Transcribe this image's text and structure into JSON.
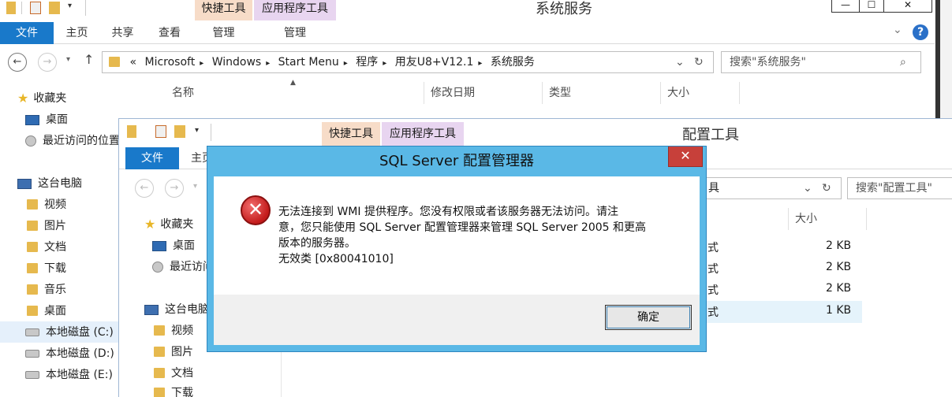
{
  "back_window": {
    "title": "系统服务",
    "ctx_tabs": [
      "快捷工具",
      "应用程序工具"
    ],
    "ribbon_tabs": [
      "文件",
      "主页",
      "共享",
      "查看",
      "管理",
      "管理"
    ],
    "win_buttons": [
      "—",
      "☐",
      "✕"
    ],
    "address": {
      "prefix": "«",
      "parts": [
        "Microsoft",
        "Windows",
        "Start Menu",
        "程序",
        "用友U8+V12.1",
        "系统服务"
      ]
    },
    "search_placeholder": "搜索\"系统服务\"",
    "nav": {
      "favorites": "收藏夹",
      "desktop": "桌面",
      "recent": "最近访问的位置",
      "this_pc": "这台电脑",
      "videos": "视频",
      "pictures": "图片",
      "documents": "文档",
      "downloads": "下载",
      "music": "音乐",
      "desktop2": "桌面",
      "drive_c": "本地磁盘 (C:)",
      "drive_d": "本地磁盘 (D:)",
      "drive_e": "本地磁盘 (E:)"
    },
    "columns": [
      "名称",
      "修改日期",
      "类型",
      "大小"
    ]
  },
  "mid_window": {
    "title": "配置工具",
    "ctx_tabs": [
      "快捷工具",
      "应用程序工具"
    ],
    "ribbon_tabs": [
      "文件",
      "主页"
    ],
    "address_tail": "具",
    "search_placeholder": "搜索\"配置工具\"",
    "nav": {
      "favorites": "收藏夹",
      "desktop": "桌面",
      "recent": "最近访问的位置",
      "this_pc": "这台电脑",
      "videos": "视频",
      "pictures": "图片",
      "documents": "文档",
      "downloads": "下载"
    },
    "size_header": "大小",
    "rows": [
      {
        "type": "式",
        "size": "2 KB"
      },
      {
        "type": "式",
        "size": "2 KB"
      },
      {
        "type": "式",
        "size": "2 KB"
      },
      {
        "type": "式",
        "size": "1 KB"
      }
    ]
  },
  "dialog": {
    "title": "SQL Server 配置管理器",
    "close": "✕",
    "message_lines": [
      "无法连接到 WMI 提供程序。您没有权限或者该服务器无法访问。请注",
      "意，您只能使用 SQL Server 配置管理器来管理 SQL Server 2005 和更高",
      "版本的服务器。",
      "无效类 [0x80041010]"
    ],
    "ok_label": "确定"
  }
}
